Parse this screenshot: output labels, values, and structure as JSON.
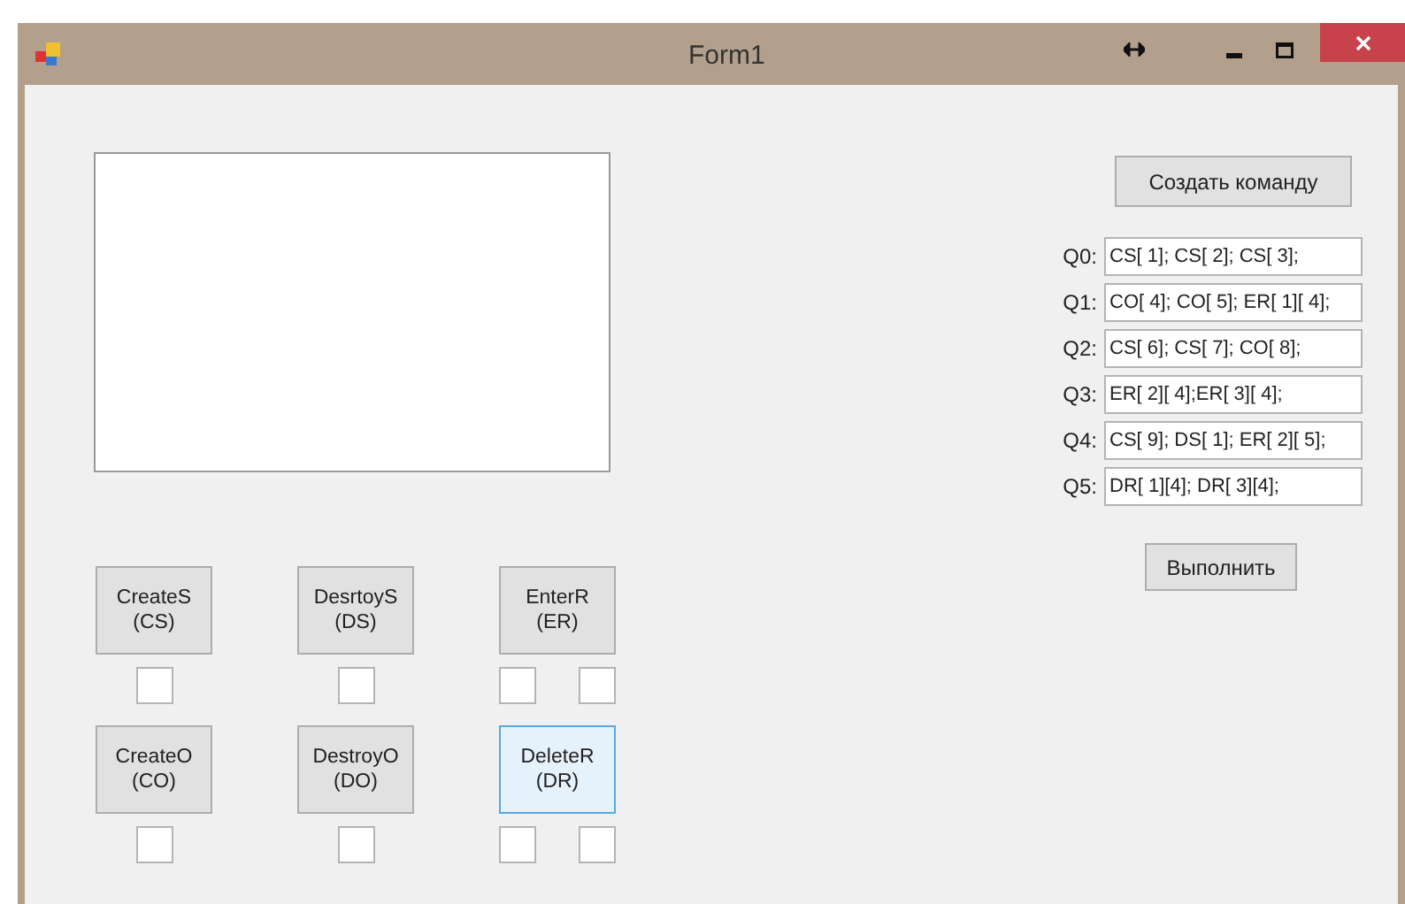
{
  "window": {
    "title": "Form1"
  },
  "output_box": {
    "kind": "textbox"
  },
  "command_buttons": [
    {
      "label": "CreateS\n(CS)",
      "focused": false,
      "fields": [
        {
          "kind": "textbox"
        }
      ]
    },
    {
      "label": "DesrtoyS\n(DS)",
      "focused": false,
      "fields": [
        {
          "kind": "textbox"
        }
      ]
    },
    {
      "label": "EnterR\n(ER)",
      "focused": false,
      "fields": [
        {
          "kind": "textbox"
        },
        {
          "kind": "textbox"
        }
      ]
    },
    {
      "label": "CreateO\n(CO)",
      "focused": false,
      "fields": [
        {
          "kind": "textbox"
        }
      ]
    },
    {
      "label": "DestroyO\n(DO)",
      "focused": false,
      "fields": [
        {
          "kind": "textbox"
        }
      ]
    },
    {
      "label": "DeleteR\n(DR)",
      "focused": true,
      "fields": [
        {
          "kind": "textbox"
        },
        {
          "kind": "textbox"
        }
      ]
    }
  ],
  "create_button": {
    "label": "Создать команду"
  },
  "queues": [
    {
      "label": "Q0:",
      "value": "CS[ 1]; CS[ 2]; CS[ 3];"
    },
    {
      "label": "Q1:",
      "value": "CO[ 4]; CO[ 5]; ER[ 1][ 4];"
    },
    {
      "label": "Q2:",
      "value": "CS[ 6]; CS[ 7]; CO[ 8];"
    },
    {
      "label": "Q3:",
      "value": "ER[ 2][ 4];ER[ 3][ 4];"
    },
    {
      "label": "Q4:",
      "value": "CS[ 9]; DS[ 1]; ER[ 2][ 5];"
    },
    {
      "label": "Q5:",
      "value": "DR[ 1][4]; DR[ 3][4];"
    }
  ],
  "run_button": {
    "label": "Выполнить"
  }
}
